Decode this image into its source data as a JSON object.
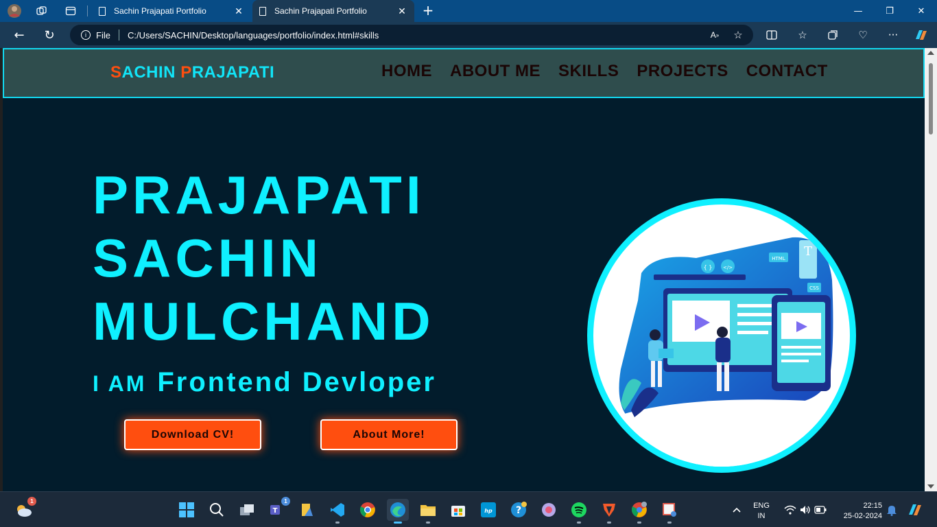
{
  "browser": {
    "tabs": [
      {
        "label": "Sachin Prajapati Portfolio",
        "active": false
      },
      {
        "label": "Sachin Prajapati Portfolio",
        "active": true
      }
    ],
    "address": {
      "scheme_label": "File",
      "url": "C:/Users/SACHIN/Desktop/languages/portfolio/index.html#skills"
    }
  },
  "site": {
    "brand": {
      "first_initial": "S",
      "first_rest": "ACHIN ",
      "last_initial": "P",
      "last_rest": "RAJAPATI"
    },
    "nav": [
      "HOME",
      "ABOUT ME",
      "SKILLS",
      "PROJECTS",
      "CONTACT"
    ],
    "hero": {
      "name_lines": [
        "PRAJAPATI",
        "SACHIN",
        "MULCHAND"
      ],
      "role_prefix": "I AM",
      "role": "Frontend Devloper",
      "cta_cv": "Download CV!",
      "cta_more": "About More!"
    },
    "art_labels": {
      "html": "HTML",
      "css": "CSS",
      "text": "T",
      "code": "</>",
      "braces": "{ }"
    }
  },
  "taskbar": {
    "weather_badge": "1",
    "teams_badge": "1",
    "language": {
      "line1": "ENG",
      "line2": "IN"
    },
    "time": "22:15",
    "date": "25-02-2024"
  },
  "colors": {
    "accent_cyan": "#0ff0ff",
    "accent_orange": "#ff4e0f",
    "page_bg": "#021c2c",
    "nav_bg": "#2f4d4d"
  }
}
